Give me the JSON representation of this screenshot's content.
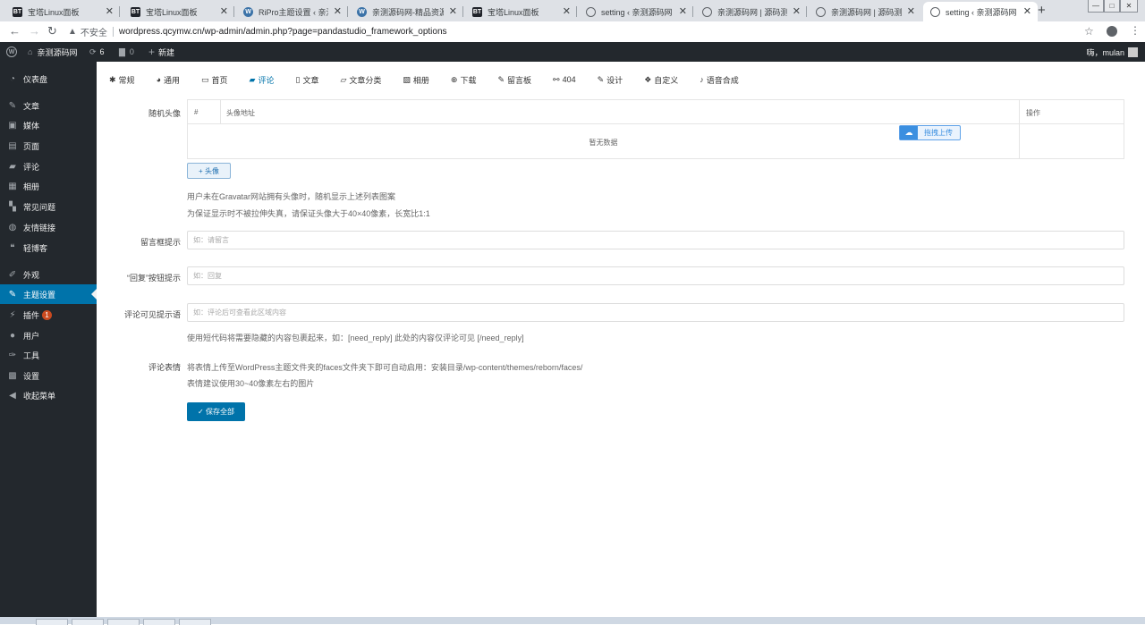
{
  "browser": {
    "tabs": [
      {
        "favicon": "bt",
        "label": "宝塔Linux面板"
      },
      {
        "favicon": "bt",
        "label": "宝塔Linux面板"
      },
      {
        "favicon": "wp",
        "label": "RiPro主题设置 ‹ 亲测源"
      },
      {
        "favicon": "wp",
        "label": "亲测源码网-精品资源站"
      },
      {
        "favicon": "bt",
        "label": "宝塔Linux面板"
      },
      {
        "favicon": "globe",
        "label": "setting ‹ 亲测源码网 —"
      },
      {
        "favicon": "globe",
        "label": "亲测源码网 | 源码测试"
      },
      {
        "favicon": "globe",
        "label": "亲测源码网 | 源码测试"
      },
      {
        "favicon": "globe",
        "label": "setting ‹ 亲测源码网 —"
      }
    ],
    "insecure_label": "不安全",
    "url": "wordpress.qcymw.cn/wp-admin/admin.php?page=pandastudio_framework_options"
  },
  "adminbar": {
    "site_name": "亲测源码网",
    "updates_count": "6",
    "comments_count": "0",
    "new_label": "新建",
    "greeting": "嗨，mulan"
  },
  "sidebar": {
    "items": [
      {
        "icon": "dashboard-icon",
        "label": "仪表盘"
      },
      {
        "icon": "pin-icon",
        "label": "文章"
      },
      {
        "icon": "media-icon",
        "label": "媒体"
      },
      {
        "icon": "page-icon",
        "label": "页面"
      },
      {
        "icon": "comment-icon",
        "label": "评论"
      },
      {
        "icon": "album-icon",
        "label": "相册"
      },
      {
        "icon": "faq-icon",
        "label": "常见问题"
      },
      {
        "icon": "links-icon",
        "label": "友情链接"
      },
      {
        "icon": "quote-icon",
        "label": "轻博客"
      },
      {
        "icon": "appearance-icon",
        "label": "外观"
      },
      {
        "icon": "brush-icon",
        "label": "主题设置"
      },
      {
        "icon": "plugin-icon",
        "label": "插件",
        "badge": "1"
      },
      {
        "icon": "user-icon",
        "label": "用户"
      },
      {
        "icon": "wrench-icon",
        "label": "工具"
      },
      {
        "icon": "settings-icon",
        "label": "设置"
      },
      {
        "icon": "collapse-icon",
        "label": "收起菜单"
      }
    ]
  },
  "tabs": [
    {
      "icon": "gear-icon",
      "label": "常规"
    },
    {
      "icon": "gauge-icon",
      "label": "通用"
    },
    {
      "icon": "monitor-icon",
      "label": "首页"
    },
    {
      "icon": "comment-icon",
      "label": "评论"
    },
    {
      "icon": "document-icon",
      "label": "文章"
    },
    {
      "icon": "folder-icon",
      "label": "文章分类"
    },
    {
      "icon": "image-icon",
      "label": "相册"
    },
    {
      "icon": "download-icon",
      "label": "下载"
    },
    {
      "icon": "edit-icon",
      "label": "留言板"
    },
    {
      "icon": "broken-link-icon",
      "label": "404"
    },
    {
      "icon": "brush-icon",
      "label": "设计"
    },
    {
      "icon": "cubes-icon",
      "label": "自定义"
    },
    {
      "icon": "microphone-icon",
      "label": "语音合成"
    }
  ],
  "active_tab": "评论",
  "form": {
    "random_avatar": {
      "label": "随机头像",
      "col_index": "#",
      "col_url": "头像地址",
      "col_action": "操作",
      "empty_text": "暂无数据",
      "upload_label": "拖拽上传",
      "add_label": "+ 头像",
      "help1": "用户未在Gravatar网站拥有头像时，随机显示上述列表图案",
      "help2": "为保证显示时不被拉伸失真，请保证头像大于40×40像素，长宽比1:1"
    },
    "comment_placeholder": {
      "label": "留言框提示",
      "placeholder": "如：请留言"
    },
    "reply_button": {
      "label": "“回复”按钮提示",
      "placeholder": "如：回复"
    },
    "comment_visible": {
      "label": "评论可见提示语",
      "placeholder": "如：评论后可查看此区域内容",
      "help": "使用短代码将需要隐藏的内容包裹起来，如：[need_reply] 此处的内容仅评论可见 [/need_reply]"
    },
    "emoji": {
      "label": "评论表情",
      "help1": "将表情上传至WordPress主题文件夹的faces文件夹下即可自动启用：安装目录/wp-content/themes/reborn/faces/",
      "help2": "表情建议使用30~40像素左右的图片"
    },
    "save_label": "✓ 保存全部"
  },
  "colors": {
    "accent": "#0073aa",
    "admin_bar": "#23282d",
    "badge": "#ca4a1f"
  }
}
